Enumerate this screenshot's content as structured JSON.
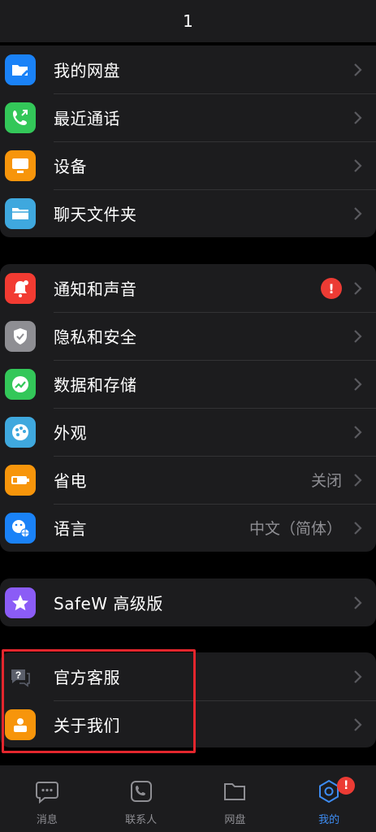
{
  "header": {
    "title": "1"
  },
  "colors": {
    "accent": "#3d8cf2",
    "alert": "#ec3b34",
    "highlight": "#e3262d",
    "cell_bg": "#1c1c1e"
  },
  "group1": [
    {
      "label": "我的网盘",
      "icon": "cloud-folder-icon",
      "color": "#1a82f7"
    },
    {
      "label": "最近通话",
      "icon": "phone-icon",
      "color": "#33c759"
    },
    {
      "label": "设备",
      "icon": "monitor-icon",
      "color": "#f7950b"
    },
    {
      "label": "聊天文件夹",
      "icon": "folder-icon",
      "color": "#3fa8de"
    }
  ],
  "group2": [
    {
      "label": "通知和声音",
      "icon": "bell-icon",
      "color": "#f23b32",
      "badge": "!"
    },
    {
      "label": "隐私和安全",
      "icon": "shield-icon",
      "color": "#8e8e93"
    },
    {
      "label": "数据和存储",
      "icon": "chart-icon",
      "color": "#33c759"
    },
    {
      "label": "外观",
      "icon": "palette-icon",
      "color": "#3fa8de"
    },
    {
      "label": "省电",
      "icon": "battery-icon",
      "color": "#f7950b",
      "value": "关闭"
    },
    {
      "label": "语言",
      "icon": "globe-icon",
      "color": "#1a82f7",
      "value": "中文（简体）"
    }
  ],
  "group3": [
    {
      "label": "SafeW 高级版",
      "icon": "star-icon",
      "color": "#8b5cf6"
    }
  ],
  "group4": [
    {
      "label": "官方客服",
      "icon": "question-bubble-icon",
      "color": "#5b5f6b"
    },
    {
      "label": "关于我们",
      "icon": "person-icon",
      "color": "#f7950b"
    }
  ],
  "tabbar": {
    "tabs": [
      {
        "label": "消息",
        "icon": "chat-bubble-icon"
      },
      {
        "label": "联系人",
        "icon": "contacts-phone-icon"
      },
      {
        "label": "网盘",
        "icon": "drive-folder-icon"
      },
      {
        "label": "我的",
        "icon": "profile-gear-icon",
        "badge": "!",
        "active": true
      }
    ]
  }
}
